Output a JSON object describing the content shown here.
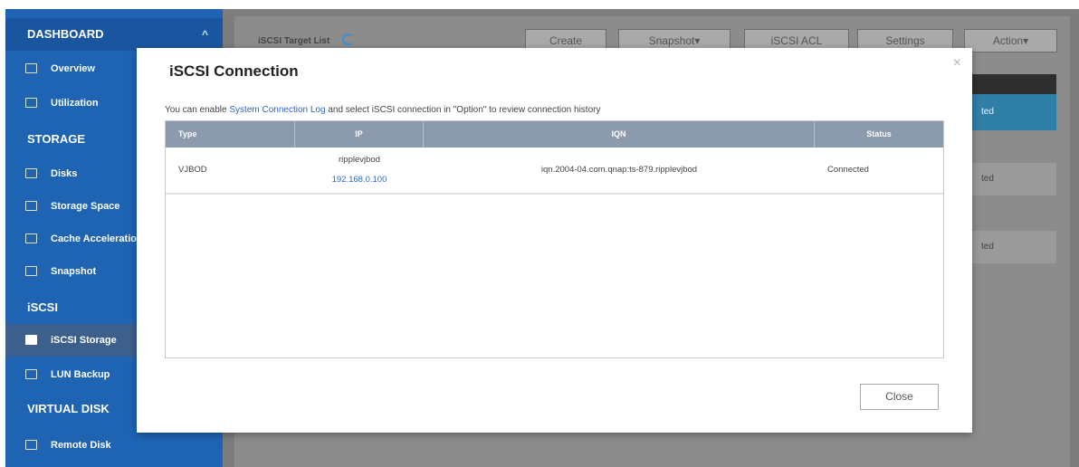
{
  "sidebar": {
    "sections": [
      {
        "label": "DASHBOARD",
        "chevron": "^"
      },
      {
        "label": "STORAGE"
      },
      {
        "label": "iSCSI"
      },
      {
        "label": "VIRTUAL DISK"
      }
    ],
    "items": [
      {
        "label": "Overview",
        "icon": "overview-icon"
      },
      {
        "label": "Utilization",
        "icon": "utilization-icon"
      },
      {
        "label": "Disks",
        "icon": "disks-icon"
      },
      {
        "label": "Storage Space",
        "icon": "storage-space-icon"
      },
      {
        "label": "Cache Acceleratio",
        "icon": "cache-icon"
      },
      {
        "label": "Snapshot",
        "icon": "snapshot-icon"
      },
      {
        "label": "iSCSI Storage",
        "icon": "iscsi-storage-icon"
      },
      {
        "label": "LUN Backup",
        "icon": "lun-backup-icon"
      },
      {
        "label": "Remote Disk",
        "icon": "remote-disk-icon"
      }
    ]
  },
  "background": {
    "list_title": "iSCSI Target List",
    "buttons": {
      "create": "Create",
      "snapshot": "Snapshot▾",
      "acl": "iSCSI ACL",
      "settings": "Settings",
      "action": "Action▾"
    },
    "row_status_1": "ted",
    "row_status_2": "ted",
    "row_status_3": "ted"
  },
  "dialog": {
    "title": "iSCSI Connection",
    "close_x": "×",
    "desc_before": "You can enable ",
    "desc_link": "System Connection Log",
    "desc_after": " and select iSCSI connection in \"Option\" to review connection history",
    "columns": {
      "type": "Type",
      "ip": "IP",
      "iqn": "IQN",
      "status": "Status"
    },
    "rows": [
      {
        "type": "VJBOD",
        "host": "ripplevjbod",
        "ip": "192.168.0.100",
        "iqn": "iqn.2004-04.com.qnap:ts-879.ripplevjbod",
        "status": "Connected"
      }
    ],
    "close_button": "Close"
  },
  "colors": {
    "sidebar": "#1f63b3",
    "accent_link": "#2d67c9",
    "grid_header": "#8c9aad"
  }
}
